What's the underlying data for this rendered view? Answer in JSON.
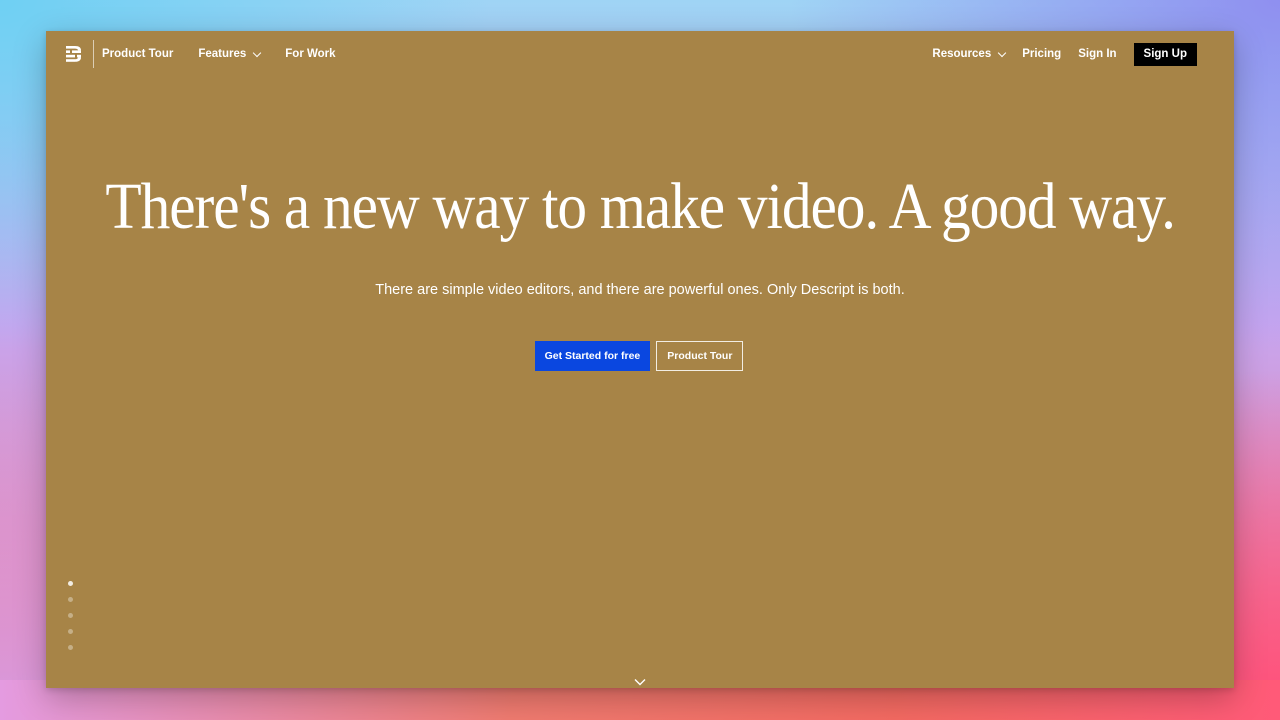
{
  "nav": {
    "logo": "descript-logo-icon",
    "left_links": [
      {
        "label": "Product Tour"
      },
      {
        "label": "Features",
        "has_dropdown": true
      },
      {
        "label": "For Work"
      }
    ],
    "right_links": [
      {
        "label": "Resources",
        "has_dropdown": true
      },
      {
        "label": "Pricing"
      },
      {
        "label": "Sign In"
      }
    ],
    "signup_label": "Sign Up"
  },
  "hero": {
    "title": "There's a new way to make video. A good way.",
    "subtitle": "There are simple video editors, and there are powerful ones. Only Descript is both.",
    "primary_cta": "Get Started for free",
    "secondary_cta": "Product Tour"
  },
  "pagination": {
    "total": 5,
    "active_index": 0
  },
  "colors": {
    "page_background": "#a78447",
    "primary_button": "#0a47e0",
    "signup_button": "#000000",
    "text": "#ffffff"
  }
}
